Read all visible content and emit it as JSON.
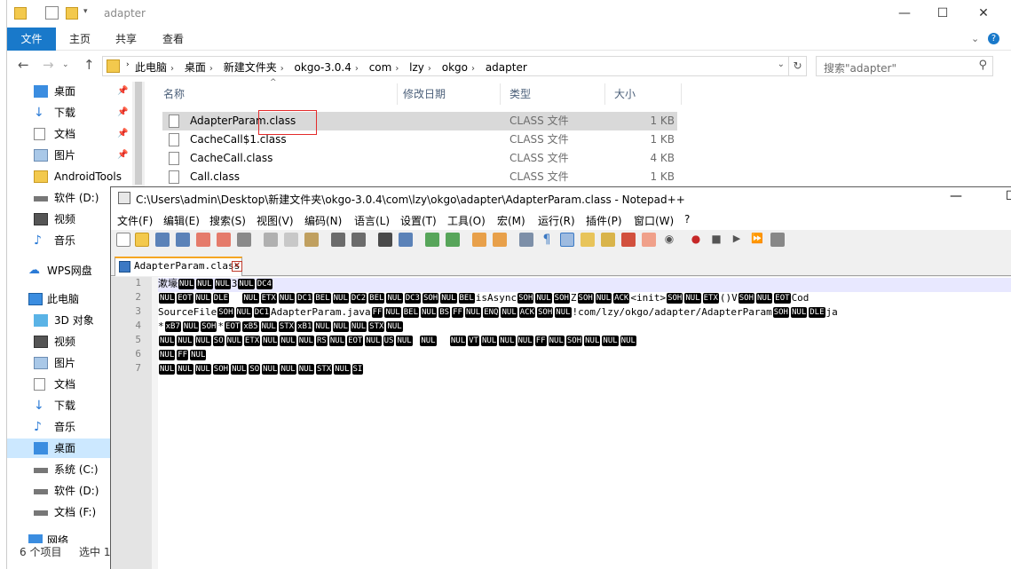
{
  "explorer": {
    "title": "adapter",
    "ribbon_tabs": [
      "文件",
      "主页",
      "共享",
      "查看"
    ],
    "window_buttons": [
      "—",
      "☐",
      "✕"
    ],
    "breadcrumbs": [
      "此电脑",
      "桌面",
      "新建文件夹",
      "okgo-3.0.4",
      "com",
      "lzy",
      "okgo",
      "adapter"
    ],
    "search_placeholder": "搜索\"adapter\"",
    "columns": [
      "名称",
      "修改日期",
      "类型",
      "大小"
    ],
    "files": [
      {
        "name": "AdapterParam.class",
        "type": "CLASS 文件",
        "size": "1 KB"
      },
      {
        "name": "CacheCall$1.class",
        "type": "CLASS 文件",
        "size": "1 KB"
      },
      {
        "name": "CacheCall.class",
        "type": "CLASS 文件",
        "size": "4 KB"
      },
      {
        "name": "Call.class",
        "type": "CLASS 文件",
        "size": "1 KB"
      }
    ],
    "nav_items": [
      {
        "label": "桌面",
        "icon": "desktop-icon"
      },
      {
        "label": "下载",
        "icon": "download-icon"
      },
      {
        "label": "文档",
        "icon": "document-icon"
      },
      {
        "label": "图片",
        "icon": "picture-icon"
      },
      {
        "label": "AndroidTools",
        "icon": "folder-icon"
      },
      {
        "label": "软件 (D:)",
        "icon": "drive-icon"
      },
      {
        "label": "视频",
        "icon": "video-icon"
      },
      {
        "label": "音乐",
        "icon": "music-icon"
      },
      {
        "label": "WPS网盘",
        "icon": "cloud-icon"
      },
      {
        "label": "此电脑",
        "icon": "computer-icon"
      },
      {
        "label": "3D 对象",
        "icon": "3d-objects-icon"
      },
      {
        "label": "视频",
        "icon": "video-icon"
      },
      {
        "label": "图片",
        "icon": "picture-icon"
      },
      {
        "label": "文档",
        "icon": "document-icon"
      },
      {
        "label": "下载",
        "icon": "download-icon"
      },
      {
        "label": "音乐",
        "icon": "music-icon"
      },
      {
        "label": "桌面",
        "icon": "desktop-icon"
      },
      {
        "label": "系统 (C:)",
        "icon": "drive-icon"
      },
      {
        "label": "软件 (D:)",
        "icon": "drive-icon"
      },
      {
        "label": "文档 (F:)",
        "icon": "drive-icon"
      },
      {
        "label": "网络",
        "icon": "network-icon"
      }
    ],
    "status": {
      "count": "6 个项目",
      "selected": "选中 1"
    }
  },
  "notepad": {
    "title": "C:\\Users\\admin\\Desktop\\新建文件夹\\okgo-3.0.4\\com\\lzy\\okgo\\adapter\\AdapterParam.class - Notepad++",
    "menu": [
      "文件(F)",
      "编辑(E)",
      "搜索(S)",
      "视图(V)",
      "编码(N)",
      "语言(L)",
      "设置(T)",
      "工具(O)",
      "宏(M)",
      "运行(R)",
      "插件(P)",
      "窗口(W)",
      "?"
    ],
    "tab_label": "AdapterParam.class",
    "line_numbers": [
      "1",
      "2",
      "3",
      "4",
      "5",
      "6",
      "7"
    ],
    "lines": [
      [
        {
          "t": "漱壕"
        },
        {
          "c": "NUL"
        },
        {
          "c": "NUL"
        },
        {
          "c": "NUL"
        },
        {
          "t": "3"
        },
        {
          "c": "NUL"
        },
        {
          "c": "DC4"
        }
      ],
      [
        {
          "c": "NUL"
        },
        {
          "c": "EOT"
        },
        {
          "c": "NUL"
        },
        {
          "c": "DLE"
        },
        {
          "t": "  "
        },
        {
          "c": "NUL"
        },
        {
          "c": "ETX"
        },
        {
          "c": "NUL"
        },
        {
          "c": "DC1"
        },
        {
          "c": "BEL"
        },
        {
          "c": "NUL"
        },
        {
          "c": "DC2"
        },
        {
          "c": "BEL"
        },
        {
          "c": "NUL"
        },
        {
          "c": "DC3"
        },
        {
          "c": "SOH"
        },
        {
          "c": "NUL"
        },
        {
          "c": "BEL"
        },
        {
          "t": "isAsync"
        },
        {
          "c": "SOH"
        },
        {
          "c": "NUL"
        },
        {
          "c": "SOH"
        },
        {
          "t": "Z"
        },
        {
          "c": "SOH"
        },
        {
          "c": "NUL"
        },
        {
          "c": "ACK"
        },
        {
          "t": "<init>"
        },
        {
          "c": "SOH"
        },
        {
          "c": "NUL"
        },
        {
          "c": "ETX"
        },
        {
          "t": "()V"
        },
        {
          "c": "SOH"
        },
        {
          "c": "NUL"
        },
        {
          "c": "EOT"
        },
        {
          "t": "Cod"
        }
      ],
      [
        {
          "t": "SourceFile"
        },
        {
          "c": "SOH"
        },
        {
          "c": "NUL"
        },
        {
          "c": "DC1"
        },
        {
          "t": "AdapterParam.java"
        },
        {
          "c": "FF"
        },
        {
          "c": "NUL"
        },
        {
          "c": "BEL"
        },
        {
          "c": "NUL"
        },
        {
          "c": "BS"
        },
        {
          "c": "FF"
        },
        {
          "c": "NUL"
        },
        {
          "c": "ENQ"
        },
        {
          "c": "NUL"
        },
        {
          "c": "ACK"
        },
        {
          "c": "SOH"
        },
        {
          "c": "NUL"
        },
        {
          "t": "!com/lzy/okgo/adapter/AdapterParam"
        },
        {
          "c": "SOH"
        },
        {
          "c": "NUL"
        },
        {
          "c": "DLE"
        },
        {
          "t": "ja"
        }
      ],
      [
        {
          "t": "*"
        },
        {
          "c": "xB7"
        },
        {
          "c": "NUL"
        },
        {
          "c": "SOH"
        },
        {
          "t": "*"
        },
        {
          "c": "EOT"
        },
        {
          "c": "xB5"
        },
        {
          "c": "NUL"
        },
        {
          "c": "STX"
        },
        {
          "c": "xB1"
        },
        {
          "c": "NUL"
        },
        {
          "c": "NUL"
        },
        {
          "c": "NUL"
        },
        {
          "c": "STX"
        },
        {
          "c": "NUL"
        }
      ],
      [
        {
          "c": "NUL"
        },
        {
          "c": "NUL"
        },
        {
          "c": "NUL"
        },
        {
          "c": "SO"
        },
        {
          "c": "NUL"
        },
        {
          "c": "ETX"
        },
        {
          "c": "NUL"
        },
        {
          "c": "NUL"
        },
        {
          "c": "NUL"
        },
        {
          "c": "RS"
        },
        {
          "c": "NUL"
        },
        {
          "c": "EOT"
        },
        {
          "c": "NUL"
        },
        {
          "c": "US"
        },
        {
          "c": "NUL"
        },
        {
          "t": " "
        },
        {
          "c": "NUL"
        },
        {
          "t": "  "
        },
        {
          "c": "NUL"
        },
        {
          "c": "VT"
        },
        {
          "c": "NUL"
        },
        {
          "c": "NUL"
        },
        {
          "c": "NUL"
        },
        {
          "c": "FF"
        },
        {
          "c": "NUL"
        },
        {
          "c": "SOH"
        },
        {
          "c": "NUL"
        },
        {
          "c": "NUL"
        },
        {
          "c": "NUL"
        }
      ],
      [
        {
          "c": "NUL"
        },
        {
          "c": "FF"
        },
        {
          "c": "NUL"
        }
      ],
      [
        {
          "c": "NUL"
        },
        {
          "c": "NUL"
        },
        {
          "c": "NUL"
        },
        {
          "c": "SOH"
        },
        {
          "c": "NUL"
        },
        {
          "c": "SO"
        },
        {
          "c": "NUL"
        },
        {
          "c": "NUL"
        },
        {
          "c": "NUL"
        },
        {
          "c": "STX"
        },
        {
          "c": "NUL"
        },
        {
          "c": "SI"
        }
      ]
    ]
  }
}
